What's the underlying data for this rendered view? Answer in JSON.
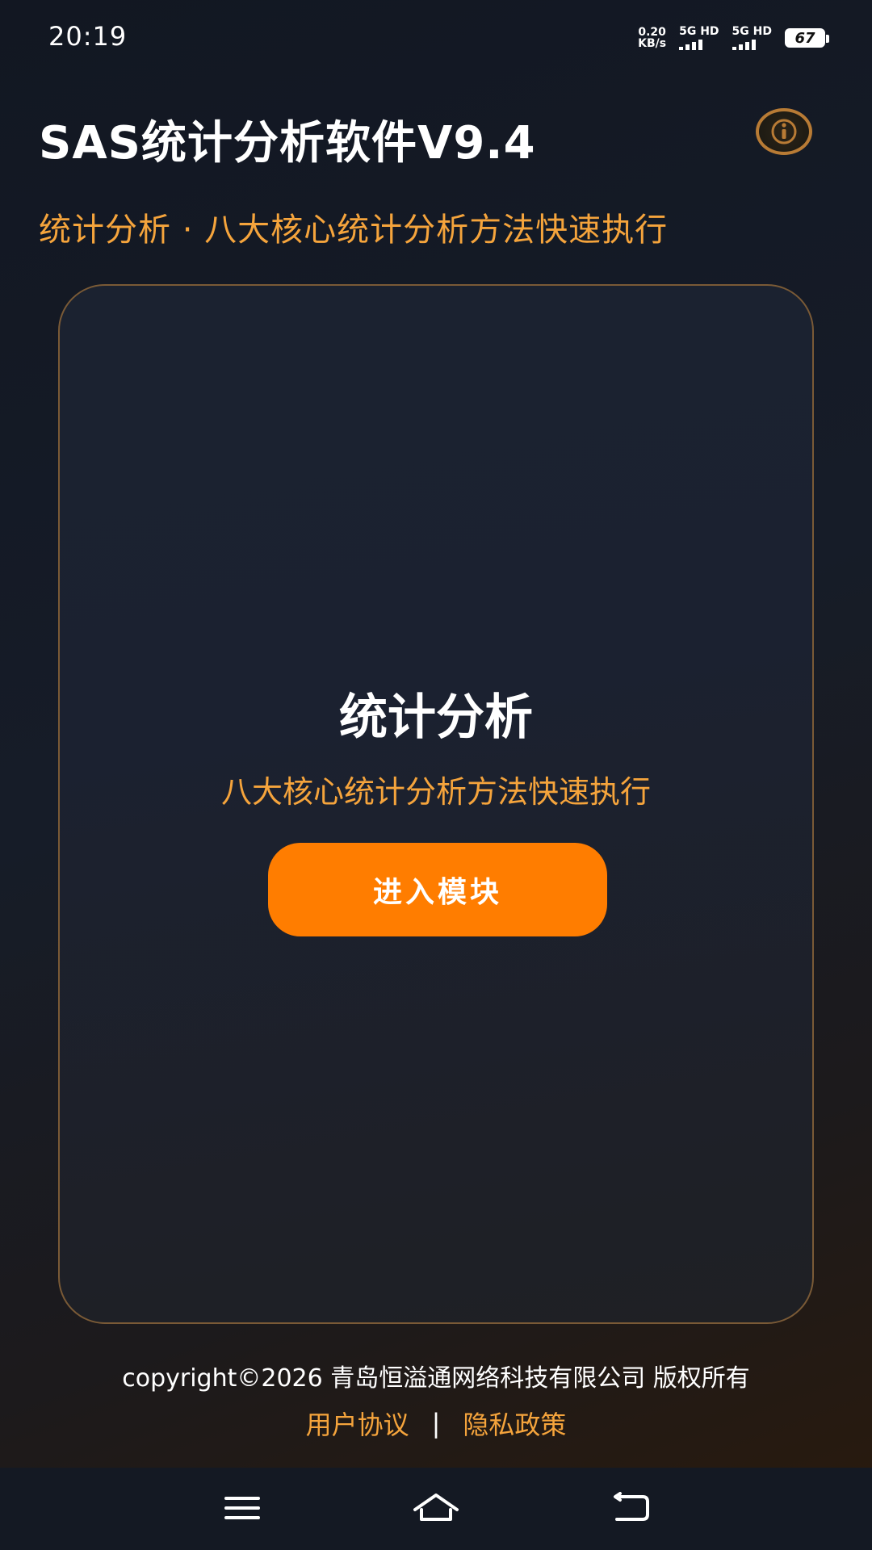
{
  "status": {
    "time": "20:19",
    "net_speed_value": "0.20",
    "net_speed_unit": "KB/s",
    "sim1_label": "5G HD",
    "sim2_label": "5G HD",
    "battery_level": "67"
  },
  "header": {
    "title": "SAS统计分析软件V9.4",
    "info_icon": "info-icon",
    "subtitle": "统计分析 · 八大核心统计分析方法快速执行"
  },
  "card": {
    "title": "统计分析",
    "subtitle": "八大核心统计分析方法快速执行",
    "button_label": "进入模块"
  },
  "footer": {
    "copyright": "copyright©2026 青岛恒溢通网络科技有限公司 版权所有",
    "user_agreement": "用户协议",
    "separator": "|",
    "privacy_policy": "隐私政策"
  },
  "navbar": {
    "menu_icon": "menu-icon",
    "home_icon": "home-icon",
    "back_icon": "back-icon"
  },
  "colors": {
    "accent": "#ff7d00",
    "accent_text": "#f5a43c",
    "card_border": "#7a5a36",
    "info_ring": "#b87b35"
  }
}
